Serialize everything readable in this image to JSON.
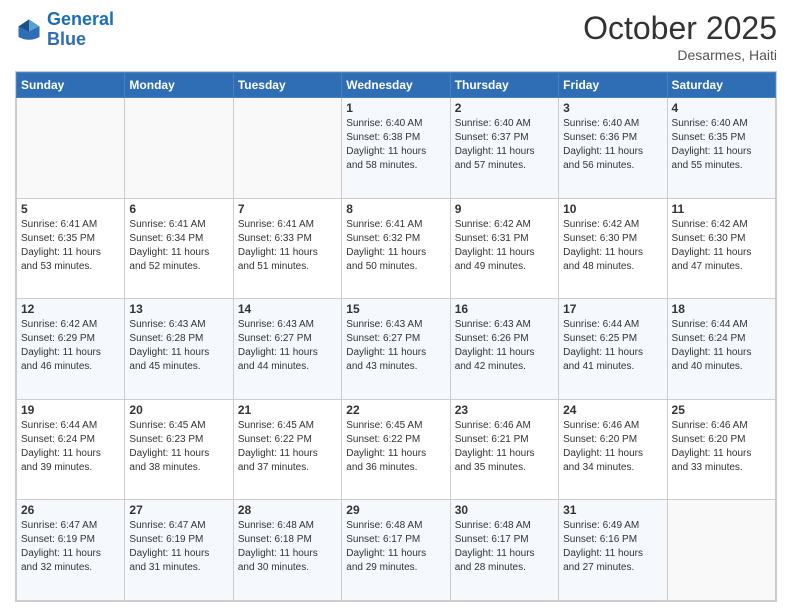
{
  "logo": {
    "line1": "General",
    "line2": "Blue"
  },
  "header": {
    "month": "October 2025",
    "location": "Desarmes, Haiti"
  },
  "days_of_week": [
    "Sunday",
    "Monday",
    "Tuesday",
    "Wednesday",
    "Thursday",
    "Friday",
    "Saturday"
  ],
  "weeks": [
    [
      {
        "day": "",
        "info": ""
      },
      {
        "day": "",
        "info": ""
      },
      {
        "day": "",
        "info": ""
      },
      {
        "day": "1",
        "info": "Sunrise: 6:40 AM\nSunset: 6:38 PM\nDaylight: 11 hours\nand 58 minutes."
      },
      {
        "day": "2",
        "info": "Sunrise: 6:40 AM\nSunset: 6:37 PM\nDaylight: 11 hours\nand 57 minutes."
      },
      {
        "day": "3",
        "info": "Sunrise: 6:40 AM\nSunset: 6:36 PM\nDaylight: 11 hours\nand 56 minutes."
      },
      {
        "day": "4",
        "info": "Sunrise: 6:40 AM\nSunset: 6:35 PM\nDaylight: 11 hours\nand 55 minutes."
      }
    ],
    [
      {
        "day": "5",
        "info": "Sunrise: 6:41 AM\nSunset: 6:35 PM\nDaylight: 11 hours\nand 53 minutes."
      },
      {
        "day": "6",
        "info": "Sunrise: 6:41 AM\nSunset: 6:34 PM\nDaylight: 11 hours\nand 52 minutes."
      },
      {
        "day": "7",
        "info": "Sunrise: 6:41 AM\nSunset: 6:33 PM\nDaylight: 11 hours\nand 51 minutes."
      },
      {
        "day": "8",
        "info": "Sunrise: 6:41 AM\nSunset: 6:32 PM\nDaylight: 11 hours\nand 50 minutes."
      },
      {
        "day": "9",
        "info": "Sunrise: 6:42 AM\nSunset: 6:31 PM\nDaylight: 11 hours\nand 49 minutes."
      },
      {
        "day": "10",
        "info": "Sunrise: 6:42 AM\nSunset: 6:30 PM\nDaylight: 11 hours\nand 48 minutes."
      },
      {
        "day": "11",
        "info": "Sunrise: 6:42 AM\nSunset: 6:30 PM\nDaylight: 11 hours\nand 47 minutes."
      }
    ],
    [
      {
        "day": "12",
        "info": "Sunrise: 6:42 AM\nSunset: 6:29 PM\nDaylight: 11 hours\nand 46 minutes."
      },
      {
        "day": "13",
        "info": "Sunrise: 6:43 AM\nSunset: 6:28 PM\nDaylight: 11 hours\nand 45 minutes."
      },
      {
        "day": "14",
        "info": "Sunrise: 6:43 AM\nSunset: 6:27 PM\nDaylight: 11 hours\nand 44 minutes."
      },
      {
        "day": "15",
        "info": "Sunrise: 6:43 AM\nSunset: 6:27 PM\nDaylight: 11 hours\nand 43 minutes."
      },
      {
        "day": "16",
        "info": "Sunrise: 6:43 AM\nSunset: 6:26 PM\nDaylight: 11 hours\nand 42 minutes."
      },
      {
        "day": "17",
        "info": "Sunrise: 6:44 AM\nSunset: 6:25 PM\nDaylight: 11 hours\nand 41 minutes."
      },
      {
        "day": "18",
        "info": "Sunrise: 6:44 AM\nSunset: 6:24 PM\nDaylight: 11 hours\nand 40 minutes."
      }
    ],
    [
      {
        "day": "19",
        "info": "Sunrise: 6:44 AM\nSunset: 6:24 PM\nDaylight: 11 hours\nand 39 minutes."
      },
      {
        "day": "20",
        "info": "Sunrise: 6:45 AM\nSunset: 6:23 PM\nDaylight: 11 hours\nand 38 minutes."
      },
      {
        "day": "21",
        "info": "Sunrise: 6:45 AM\nSunset: 6:22 PM\nDaylight: 11 hours\nand 37 minutes."
      },
      {
        "day": "22",
        "info": "Sunrise: 6:45 AM\nSunset: 6:22 PM\nDaylight: 11 hours\nand 36 minutes."
      },
      {
        "day": "23",
        "info": "Sunrise: 6:46 AM\nSunset: 6:21 PM\nDaylight: 11 hours\nand 35 minutes."
      },
      {
        "day": "24",
        "info": "Sunrise: 6:46 AM\nSunset: 6:20 PM\nDaylight: 11 hours\nand 34 minutes."
      },
      {
        "day": "25",
        "info": "Sunrise: 6:46 AM\nSunset: 6:20 PM\nDaylight: 11 hours\nand 33 minutes."
      }
    ],
    [
      {
        "day": "26",
        "info": "Sunrise: 6:47 AM\nSunset: 6:19 PM\nDaylight: 11 hours\nand 32 minutes."
      },
      {
        "day": "27",
        "info": "Sunrise: 6:47 AM\nSunset: 6:19 PM\nDaylight: 11 hours\nand 31 minutes."
      },
      {
        "day": "28",
        "info": "Sunrise: 6:48 AM\nSunset: 6:18 PM\nDaylight: 11 hours\nand 30 minutes."
      },
      {
        "day": "29",
        "info": "Sunrise: 6:48 AM\nSunset: 6:17 PM\nDaylight: 11 hours\nand 29 minutes."
      },
      {
        "day": "30",
        "info": "Sunrise: 6:48 AM\nSunset: 6:17 PM\nDaylight: 11 hours\nand 28 minutes."
      },
      {
        "day": "31",
        "info": "Sunrise: 6:49 AM\nSunset: 6:16 PM\nDaylight: 11 hours\nand 27 minutes."
      },
      {
        "day": "",
        "info": ""
      }
    ]
  ]
}
